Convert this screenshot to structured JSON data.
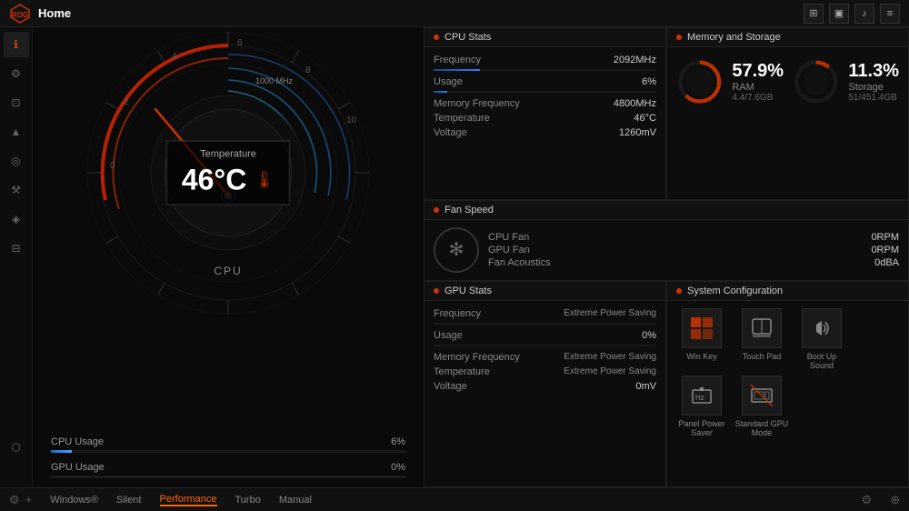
{
  "topbar": {
    "title": "Home",
    "icons": [
      "grid-icon",
      "monitor-icon",
      "speaker-icon",
      "menu-icon"
    ]
  },
  "sidebar": {
    "items": [
      {
        "icon": "ℹ",
        "label": "info",
        "active": true
      },
      {
        "icon": "⚙",
        "label": "settings"
      },
      {
        "icon": "🖥",
        "label": "display"
      },
      {
        "icon": "△",
        "label": "performance"
      },
      {
        "icon": "📷",
        "label": "camera"
      },
      {
        "icon": "🔧",
        "label": "tools"
      },
      {
        "icon": "🛡",
        "label": "shield"
      },
      {
        "icon": "📋",
        "label": "clipboard"
      },
      {
        "icon": "⚡",
        "label": "power"
      }
    ]
  },
  "gauge": {
    "cpu_label": "CPU",
    "temp_label": "Temperature",
    "temp_value": "46°C"
  },
  "usage_bars": {
    "cpu_label": "CPU Usage",
    "cpu_value": "6%",
    "cpu_percent": 6,
    "gpu_label": "GPU Usage",
    "gpu_value": "0%",
    "gpu_percent": 0
  },
  "cpu_stats": {
    "title": "CPU Stats",
    "frequency_label": "Frequency",
    "frequency_value": "2092MHz",
    "usage_label": "Usage",
    "usage_value": "6%",
    "mem_freq_label": "Memory Frequency",
    "mem_freq_value": "4800MHz",
    "temp_label": "Temperature",
    "temp_value": "46°C",
    "voltage_label": "Voltage",
    "voltage_value": "1260mV"
  },
  "memory_storage": {
    "title": "Memory and Storage",
    "ram_percent": "57.9%",
    "ram_label": "RAM",
    "ram_detail": "4.4/7.6GB",
    "ram_arc": 57.9,
    "storage_percent": "11.3%",
    "storage_label": "Storage",
    "storage_detail": "51/451.4GB",
    "storage_arc": 11.3
  },
  "fan_speed": {
    "title": "Fan Speed",
    "cpu_fan_label": "CPU Fan",
    "cpu_fan_value": "0RPM",
    "gpu_fan_label": "GPU Fan",
    "gpu_fan_value": "0RPM",
    "acoustics_label": "Fan Acoustics",
    "acoustics_value": "0dBA"
  },
  "gpu_stats": {
    "title": "GPU Stats",
    "frequency_label": "Frequency",
    "frequency_value": "Extreme Power Saving",
    "usage_label": "Usage",
    "usage_value": "0%",
    "mem_freq_label": "Memory Frequency",
    "mem_freq_value": "Extreme Power Saving",
    "temp_label": "Temperature",
    "temp_value": "Extreme Power Saving",
    "voltage_label": "Voltage",
    "voltage_value": "0mV"
  },
  "system_config": {
    "title": "System Configuration",
    "items": [
      {
        "icon": "🪟",
        "label": "Win Key"
      },
      {
        "icon": "🖱",
        "label": "Touch Pad"
      },
      {
        "icon": "🔊",
        "label": "Boot Up Sound"
      },
      {
        "icon": "🔋",
        "label": "Panel Power Saver"
      },
      {
        "icon": "🖥",
        "label": "Standard GPU Mode"
      }
    ]
  },
  "bottom_bar": {
    "items": [
      {
        "label": "Windows®",
        "active": false
      },
      {
        "label": "Silent",
        "active": false
      },
      {
        "label": "Performance",
        "active": true
      },
      {
        "label": "Turbo",
        "active": false
      },
      {
        "label": "Manual",
        "active": false
      }
    ]
  }
}
